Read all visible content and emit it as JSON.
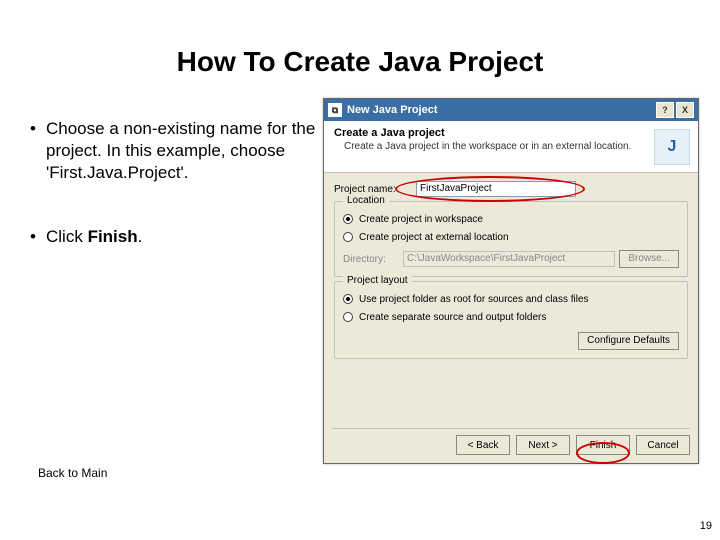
{
  "slide": {
    "title": "How To Create Java Project",
    "bullets": [
      "Choose a non-existing name for the project. In this example, choose 'First.Java.Project'.",
      "Click Finish."
    ],
    "back_link": "Back to Main",
    "page_number": "19"
  },
  "dialog": {
    "titlebar": {
      "icon_char": "⧉",
      "title": "New Java Project",
      "help": "?",
      "close": "X"
    },
    "header": {
      "title": "Create a Java project",
      "subtitle": "Create a Java project in the workspace or in an external location.",
      "icon_char": "J"
    },
    "project_name": {
      "label": "Project name:",
      "value": "FirstJavaProject"
    },
    "location": {
      "legend": "Location",
      "opt1": "Create project in workspace",
      "opt2": "Create project at external location",
      "directory_label": "Directory:",
      "directory_value": "C:\\JavaWorkspace\\FirstJavaProject",
      "browse": "Browse..."
    },
    "layout": {
      "legend": "Project layout",
      "opt1": "Use project folder as root for sources and class files",
      "opt2": "Create separate source and output folders",
      "configure": "Configure Defaults"
    },
    "buttons": {
      "back": "< Back",
      "next": "Next >",
      "finish": "Finish",
      "cancel": "Cancel"
    }
  }
}
